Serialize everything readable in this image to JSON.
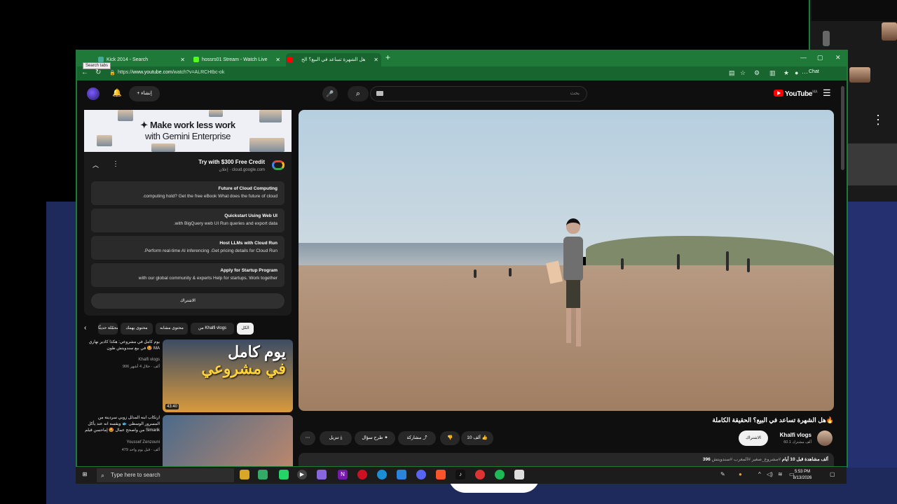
{
  "tabs": [
    {
      "label": "Kick 2014 - Search"
    },
    {
      "label": "hossrs01 Stream - Watch Live"
    },
    {
      "label": "هل الشهرة تساعد في البيع؟ الح"
    }
  ],
  "tooltip": "Search tabs",
  "address": {
    "prefix": "https://",
    "domain": "www.youtube.com",
    "path": "/watch?v=ALRCHtbc-ok"
  },
  "browser_chat": "Chat",
  "yt": {
    "logo": "YouTube",
    "logo_region": "MA",
    "search_placeholder": "بحث",
    "create_label": "إنشاء"
  },
  "ad": {
    "banner_line1": "Make work less work",
    "banner_line2": "with Gemini Enterprise",
    "title": "Try with $300 Free Credit",
    "sponsor": "إعلان · cloud.google.com",
    "links": [
      {
        "heading": "Future of Cloud Computing",
        "desc": ".computing hold? Get the free eBook What does the future of cloud"
      },
      {
        "heading": "Quickstart Using Web UI",
        "desc": ".with BigQuery web UI Run queries and export data"
      },
      {
        "heading": "Host LLMs with Cloud Run",
        "desc": ".Perform real-time AI inferencing .Get pricing details for Cloud Run"
      },
      {
        "heading": "Apply for Startup Program",
        "desc": "with our global community & experts Help for startups. Work together"
      }
    ],
    "cta": "الاشتراك"
  },
  "chips": [
    "الكل",
    "من Khalfi vlogs",
    "محتوى مشابه",
    "محتوى يهمك",
    "فيديوهات محمّلة حديثًا"
  ],
  "recs": [
    {
      "title": "يوم كامل في مشروعي: هكذا كادير نهاري في بيع سندويتش طون 🤩 MA",
      "channel": "Khalfi vlogs",
      "meta": "906 ألف · خلال 4 أشهر",
      "duration": "43:40",
      "overlay1": "يوم كامل",
      "overlay2": "في مشروعي"
    },
    {
      "title": "ارتكاب ابنه المدلل زوبي سردينة من المسرور الوسطى 🐟 ويقسه انه عند يأكل من واصحح عمال 🤩 إماحسن قيلم Simarik",
      "channel": "Youssef Zenzouni",
      "meta": "479 ألف · قبل يوم واحد"
    }
  ],
  "video": {
    "title": "هل الشهرة تساعد في البيع؟ الحقيقة الكاملة🔥",
    "channel": "Khalfi vlogs",
    "subs": "60.1 ألف مشترك",
    "subscribe": "الاشتراك",
    "likes": "10 آلف",
    "share": "مشاركة",
    "ask": "طرح سؤال",
    "download": "تنزيل",
    "views": "396 ألف مشاهدة قبل 10 أيام",
    "hashtags": "#مشروع_صغير #المغرب #سندويتش"
  },
  "taskbar": {
    "search": "Type here to search",
    "time": "5:53 PM",
    "date": "8/13/2026"
  },
  "colors": {
    "browser_frame": "#1f7a3a",
    "yt_red": "#ff0000",
    "page_bg": "#0f0f0f"
  }
}
